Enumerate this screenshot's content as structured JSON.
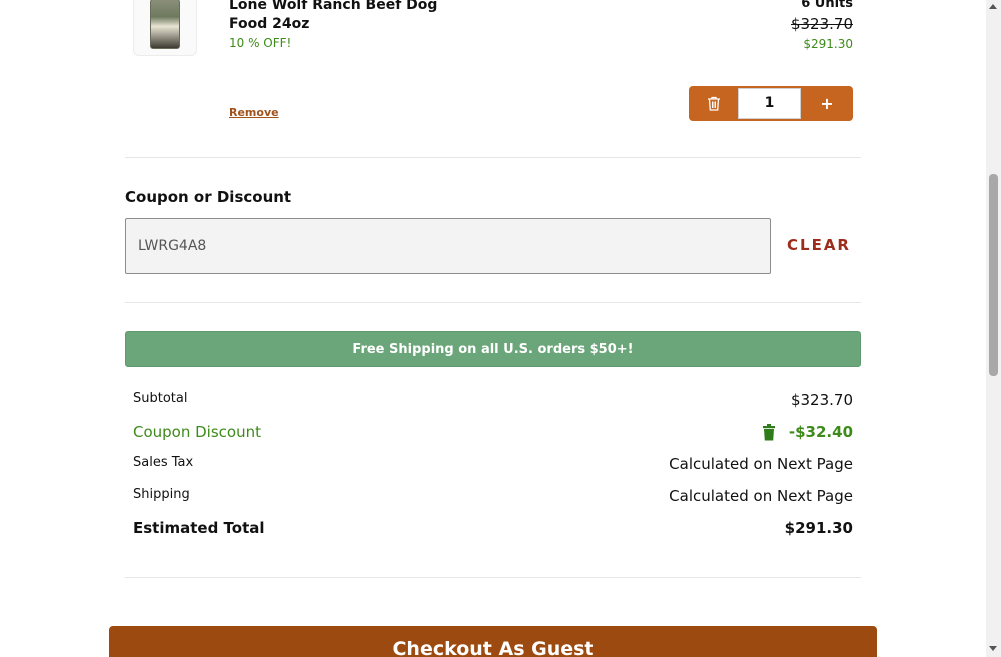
{
  "product": {
    "name": "Lone Wolf Ranch Beef Dog Food 24oz",
    "promo": "10 % OFF!",
    "units": "6 Units",
    "original_price": "$323.70",
    "sale_price": "$291.30",
    "remove_label": "Remove",
    "quantity": "1",
    "plus_label": "+"
  },
  "coupon": {
    "label": "Coupon or Discount",
    "value": "LWRG4A8",
    "clear_label": "CLEAR"
  },
  "banner": {
    "text": "Free Shipping on all U.S. orders $50+!"
  },
  "summary": {
    "subtotal_label": "Subtotal",
    "subtotal_value": "$323.70",
    "coupon_label": "Coupon Discount",
    "coupon_value": "-$32.40",
    "tax_label": "Sales Tax",
    "tax_value": "Calculated on Next Page",
    "shipping_label": "Shipping",
    "shipping_value": "Calculated on Next Page",
    "total_label": "Estimated Total",
    "total_value": "$291.30"
  },
  "checkout": {
    "guest_label": "Checkout As Guest"
  },
  "colors": {
    "accent_orange": "#c6651f",
    "checkout_brown": "#9c4a0f",
    "discount_green": "#3d8b1a",
    "banner_green": "#6ba57a",
    "clear_red": "#9c2c1c"
  },
  "icons": {
    "qty_trash": "trash-outline-icon",
    "coupon_trash": "trash-filled-icon",
    "product_image": "dog-food-bag-image"
  }
}
